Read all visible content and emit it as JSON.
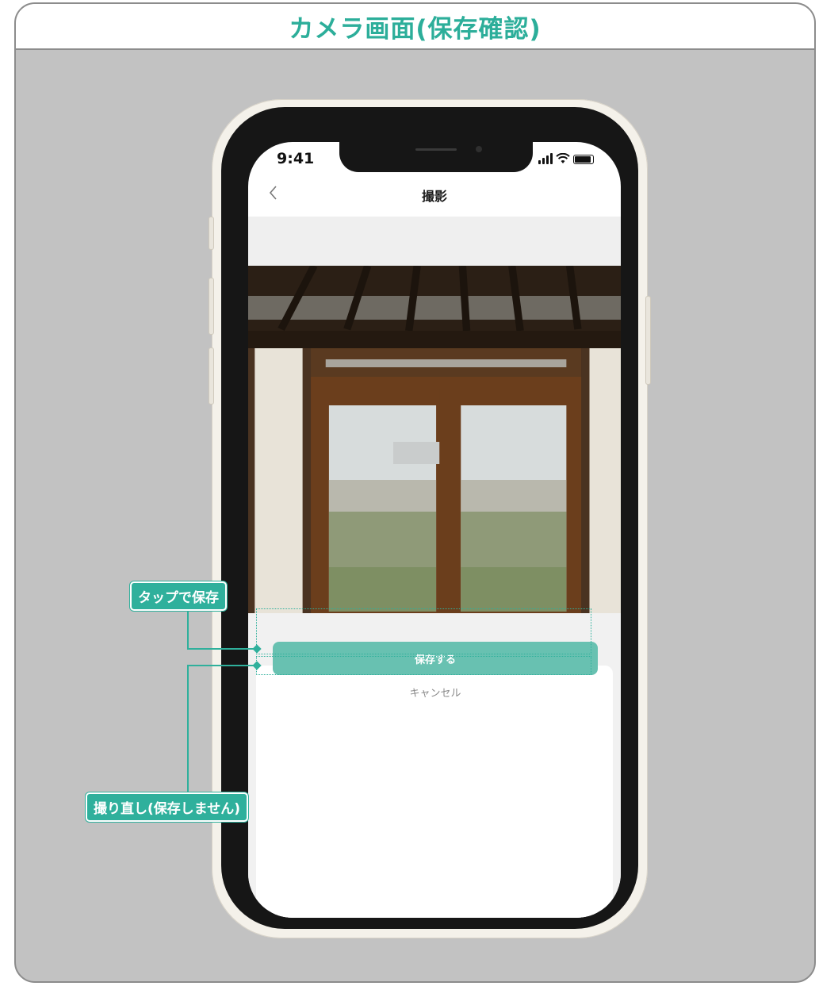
{
  "page": {
    "title": "カメラ画面(保存確認)"
  },
  "status_bar": {
    "time": "9:41"
  },
  "nav": {
    "title": "撮影"
  },
  "actions": {
    "save_label": "保存する",
    "cancel_label": "キャンセル"
  },
  "annotations": {
    "save_note": "タップで保存",
    "retake_note": "撮り直し(保存しません)"
  },
  "colors": {
    "accent": "#2fb09c",
    "save_button": "#68c1b1",
    "frame_bg": "#c2c2c2"
  },
  "icons": [
    "back-chevron-icon",
    "signal-icon",
    "wifi-icon",
    "battery-icon"
  ]
}
